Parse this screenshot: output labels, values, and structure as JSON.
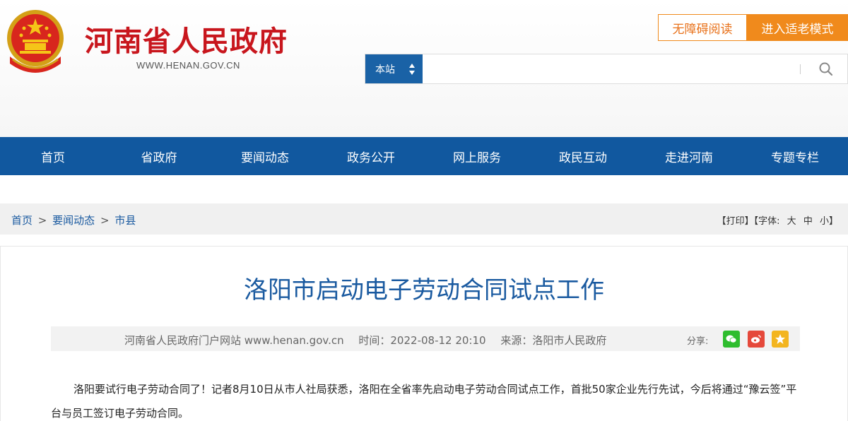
{
  "header": {
    "site_title": "河南省人民政府",
    "site_url": "WWW.HENAN.GOV.CN",
    "accessibility_label": "无障碍阅读",
    "elder_mode_label": "进入适老模式",
    "search": {
      "scope_label": "本站",
      "placeholder": ""
    }
  },
  "nav": {
    "items": [
      {
        "label": "首页"
      },
      {
        "label": "省政府"
      },
      {
        "label": "要闻动态"
      },
      {
        "label": "政务公开"
      },
      {
        "label": "网上服务"
      },
      {
        "label": "政民互动"
      },
      {
        "label": "走进河南"
      },
      {
        "label": "专题专栏"
      }
    ]
  },
  "breadcrumb": {
    "items": [
      "首页",
      "要闻动态",
      "市县"
    ],
    "separator": ">"
  },
  "tools": {
    "print": "【打印】",
    "font_prefix": "【字体:",
    "font_large": "大",
    "font_medium": "中",
    "font_small": "小",
    "font_suffix": "】"
  },
  "article": {
    "title": "洛阳市启动电子劳动合同试点工作",
    "source_site": "河南省人民政府门户网站 www.henan.gov.cn",
    "time": "时间：2022-08-12 20:10",
    "origin": "来源：洛阳市人民政府",
    "share_label": "分享:",
    "body": "洛阳要试行电子劳动合同了！记者8月10日从市人社局获悉，洛阳在全省率先启动电子劳动合同试点工作，首批50家企业先行先试，今后将通过“豫云签”平台与员工签订电子劳动合同。"
  },
  "colors": {
    "brand_red": "#c8161d",
    "nav_blue": "#11589f",
    "accent_orange": "#f08a1c",
    "link_blue": "#1a5aa0"
  }
}
